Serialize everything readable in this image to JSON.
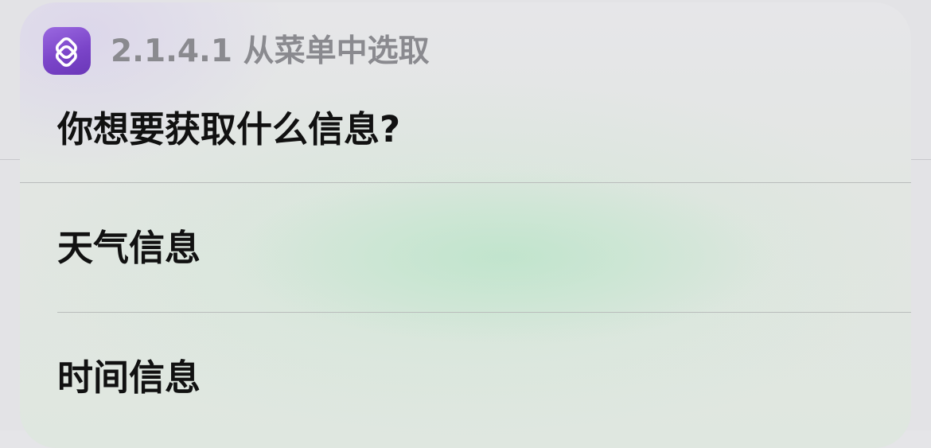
{
  "dialog": {
    "app_icon": "shortcuts-icon",
    "subtitle": "2.1.4.1 从菜单中选取",
    "prompt": "你想要获取什么信息?",
    "options": [
      {
        "label": "天气信息"
      },
      {
        "label": "时间信息"
      }
    ]
  },
  "colors": {
    "icon_purple": "#7b45c9",
    "subtitle_gray": "#8a8a8f",
    "text_black": "#111111"
  }
}
